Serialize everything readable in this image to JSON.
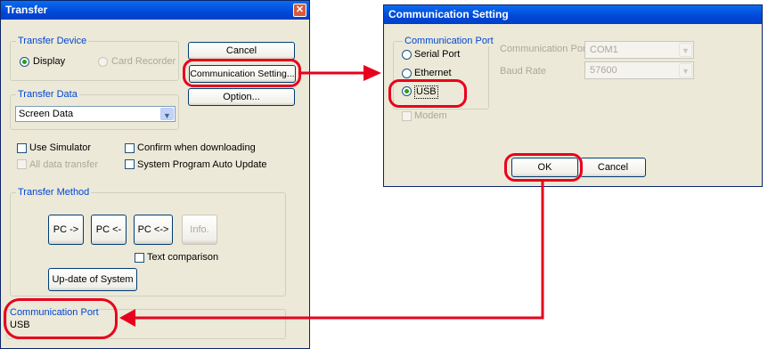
{
  "transfer_dialog": {
    "title": "Transfer",
    "transfer_device": {
      "title": "Transfer Device",
      "display_label": "Display",
      "card_recorder_label": "Card Recorder"
    },
    "buttons": {
      "cancel": "Cancel",
      "communication_setting": "Communication Setting...",
      "option": "Option..."
    },
    "transfer_data": {
      "title": "Transfer Data",
      "selected": "Screen Data"
    },
    "checkboxes": {
      "use_simulator": "Use Simulator",
      "confirm_download": "Confirm when downloading",
      "all_data_transfer": "All data transfer",
      "system_program_update": "System Program Auto Update"
    },
    "transfer_method": {
      "title": "Transfer Method",
      "pc_to": "PC ->",
      "pc_from": "PC <-",
      "pc_both": "PC <->",
      "info": "Info.",
      "text_comparison": "Text comparison",
      "update_system": "Up-date of System"
    },
    "comm_port_status": {
      "title": "Communication Port",
      "value": "USB"
    }
  },
  "comm_dialog": {
    "title": "Communication Setting",
    "port_group_title": "Communication Port",
    "options": {
      "serial": "Serial Port",
      "ethernet": "Ethernet",
      "usb": "USB"
    },
    "modem": "Modem",
    "fields": {
      "port_label": "Communication Port",
      "port_value": "COM1",
      "baud_label": "Baud Rate",
      "baud_value": "57600"
    },
    "buttons": {
      "ok": "OK",
      "cancel": "Cancel"
    }
  },
  "colors": {
    "annotation": "#e8001c",
    "title_bar": "#0054e3",
    "group_title": "#0046d5"
  }
}
